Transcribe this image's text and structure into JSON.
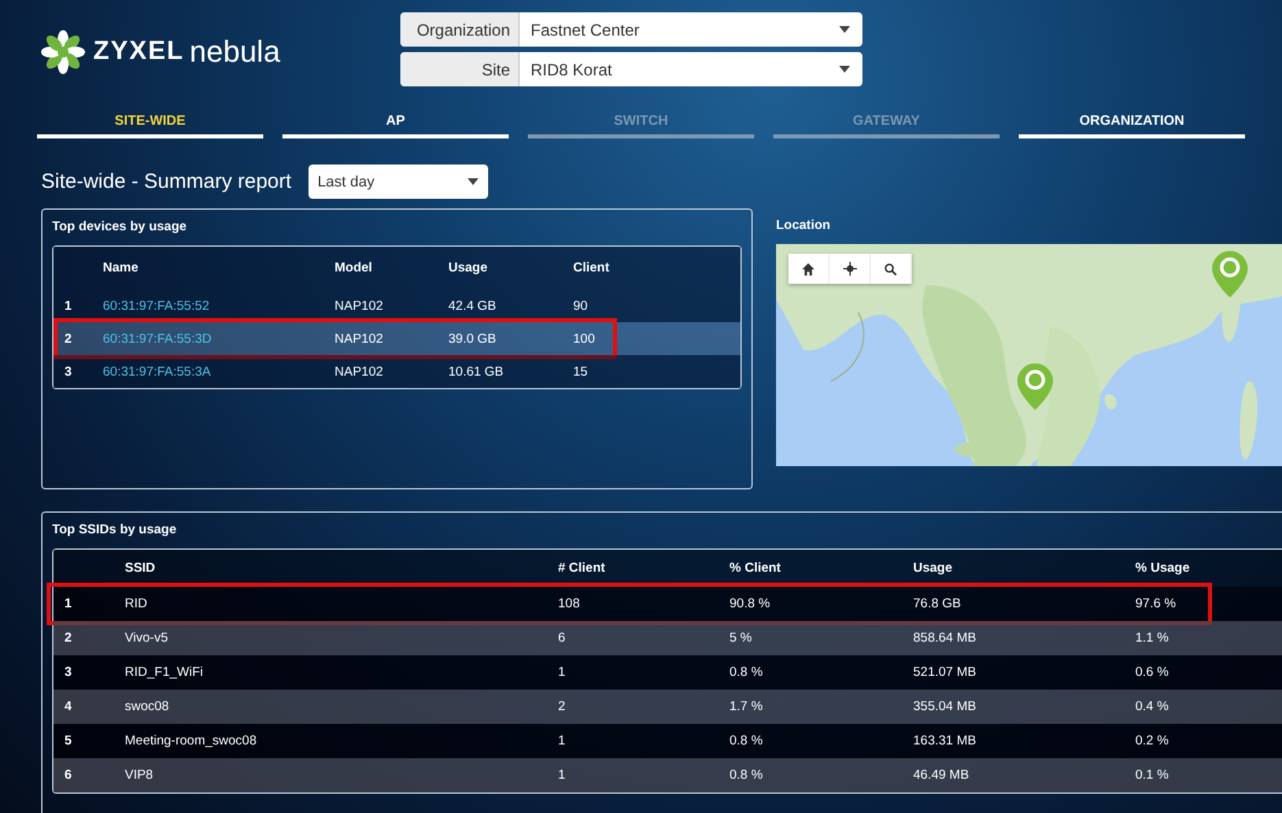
{
  "logo": {
    "brand": "ZYXEL",
    "product": "nebula"
  },
  "selectors": [
    {
      "label": "Organization",
      "value": "Fastnet Center"
    },
    {
      "label": "Site",
      "value": "RID8 Korat"
    }
  ],
  "tabs": [
    {
      "label": "SITE-WIDE",
      "selected": true,
      "disabled": false
    },
    {
      "label": "AP",
      "selected": false,
      "disabled": false
    },
    {
      "label": "SWITCH",
      "selected": false,
      "disabled": true
    },
    {
      "label": "GATEWAY",
      "selected": false,
      "disabled": true
    },
    {
      "label": "ORGANIZATION",
      "selected": false,
      "disabled": false
    }
  ],
  "page_title": "Site-wide - Summary report",
  "period": {
    "value": "Last day"
  },
  "top_devices": {
    "title": "Top devices by usage",
    "columns": [
      "Name",
      "Model",
      "Usage",
      "Client"
    ],
    "rows": [
      {
        "index": "1",
        "name": "60:31:97:FA:55:52",
        "model": "NAP102",
        "usage": "42.4 GB",
        "client": "90",
        "selected": false,
        "highlighted": false
      },
      {
        "index": "2",
        "name": "60:31:97:FA:55:3D",
        "model": "NAP102",
        "usage": "39.0 GB",
        "client": "100",
        "selected": true,
        "highlighted": true
      },
      {
        "index": "3",
        "name": "60:31:97:FA:55:3A",
        "model": "NAP102",
        "usage": "10.61 GB",
        "client": "15",
        "selected": false,
        "highlighted": false
      }
    ]
  },
  "location": {
    "title": "Location"
  },
  "top_ssids": {
    "title": "Top SSIDs by usage",
    "columns": [
      "SSID",
      "# Client",
      "% Client",
      "Usage",
      "% Usage"
    ],
    "rows": [
      {
        "index": "1",
        "ssid": "RID",
        "clients": "108",
        "client_share": "90.8 %",
        "usage": "76.8 GB",
        "usage_share": "97.6 %",
        "highlighted": true
      },
      {
        "index": "2",
        "ssid": "Vivo-v5",
        "clients": "6",
        "client_share": "5 %",
        "usage": "858.64 MB",
        "usage_share": "1.1 %",
        "highlighted": false
      },
      {
        "index": "3",
        "ssid": "RID_F1_WiFi",
        "clients": "1",
        "client_share": "0.8 %",
        "usage": "521.07 MB",
        "usage_share": "0.6 %",
        "highlighted": false
      },
      {
        "index": "4",
        "ssid": "swoc08",
        "clients": "2",
        "client_share": "1.7 %",
        "usage": "355.04 MB",
        "usage_share": "0.4 %",
        "highlighted": false
      },
      {
        "index": "5",
        "ssid": "Meeting-room_swoc08",
        "clients": "1",
        "client_share": "0.8 %",
        "usage": "163.31 MB",
        "usage_share": "0.2 %",
        "highlighted": false
      },
      {
        "index": "6",
        "ssid": "VIP8",
        "clients": "1",
        "client_share": "0.8 %",
        "usage": "46.49 MB",
        "usage_share": "0.1 %",
        "highlighted": false
      }
    ]
  }
}
